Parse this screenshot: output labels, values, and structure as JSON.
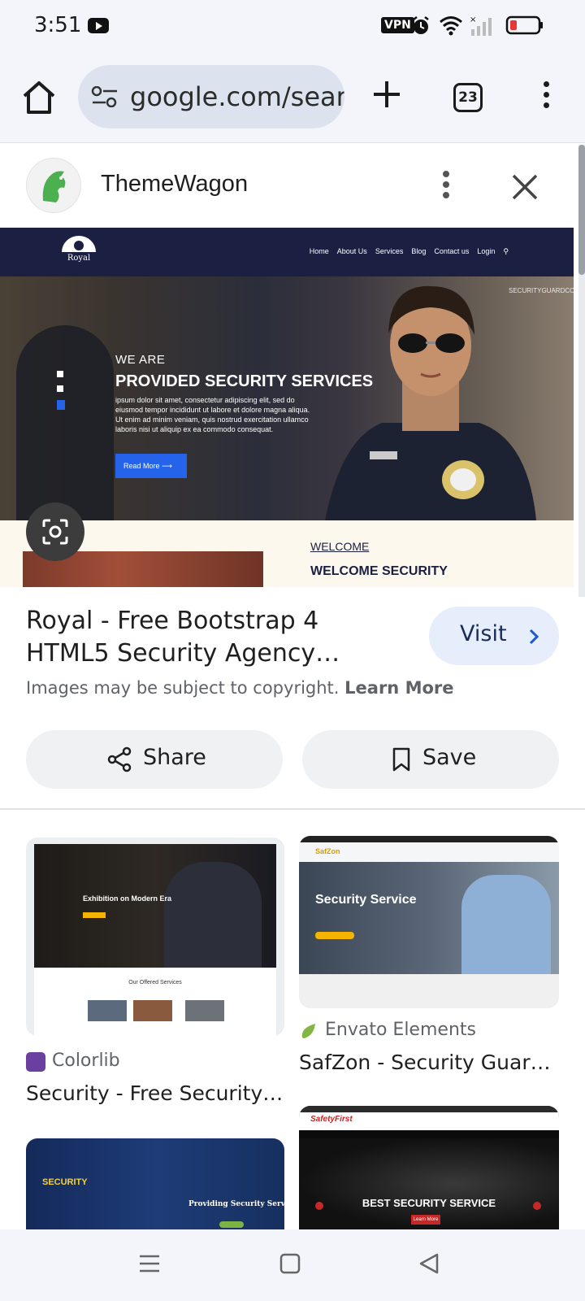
{
  "status_bar": {
    "time": "3:51",
    "vpn": "VPN"
  },
  "toolbar": {
    "url": "google.com/search",
    "tab_count": "23"
  },
  "source": {
    "name": "ThemeWagon"
  },
  "preview": {
    "logo_text": "Royal",
    "nav_items": [
      "Home",
      "About Us",
      "Services",
      "Blog",
      "Contact us",
      "Login"
    ],
    "we_are": "WE ARE",
    "headline": "PROVIDED SECURITY SERVICES",
    "body": "ipsum dolor sit amet, consectetur adipiscing elit, sed do eiusmod tempor incididunt ut labore et dolore magna aliqua. Ut enim ad minim veniam, quis nostrud exercitation ullamco laboris nisi ut aliquip ex ea commodo consequat.",
    "button": "Read More",
    "vertical_text": "SECURITYGUARDCOMPANY",
    "welcome": "WELCOME",
    "welcome_heading": "WELCOME SECURITY"
  },
  "result": {
    "title": "Royal - Free Bootstrap 4 HTML5 Security Agency…",
    "visit_label": "Visit",
    "copyright_text": "Images may be subject to copyright.",
    "learn_more": "Learn More",
    "share_label": "Share",
    "save_label": "Save"
  },
  "related": [
    {
      "source": "Colorlib",
      "title": "Security - Free Security…",
      "thumb_heading": "Exhibition on Modern Era",
      "thumb_section": "Our Offered Services"
    },
    {
      "source": "Envato Elements",
      "title": "SafZon - Security Guar…",
      "thumb_brand": "SafZon",
      "thumb_heading": "Security Service"
    },
    {
      "thumb_label": "SECURITY",
      "thumb_heading": "Providing Security Services"
    },
    {
      "thumb_brand": "SafetyFirst",
      "thumb_heading": "BEST SECURITY SERVICE",
      "thumb_button": "Learn More"
    }
  ],
  "colors": {
    "accent_blue": "#2563eb",
    "dark_navy": "#1b1f41",
    "visit_bg": "#e6edfb"
  }
}
